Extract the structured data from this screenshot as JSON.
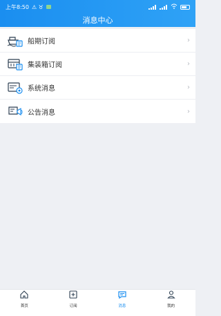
{
  "status_bar": {
    "time": "上午8:50",
    "left_glyphs": "⚠ ♉",
    "battery": "55"
  },
  "header": {
    "title": "消息中心"
  },
  "menu": {
    "items": [
      {
        "label": "船期订阅",
        "icon": "ship-icon"
      },
      {
        "label": "集装箱订阅",
        "icon": "container-icon"
      },
      {
        "label": "系统消息",
        "icon": "system-message-icon"
      },
      {
        "label": "公告消息",
        "icon": "announcement-icon"
      }
    ]
  },
  "tabbar": {
    "tabs": [
      {
        "label": "首页",
        "icon": "home-icon",
        "active": false
      },
      {
        "label": "订阅",
        "icon": "subscribe-icon",
        "active": false
      },
      {
        "label": "消息",
        "icon": "message-icon",
        "active": true
      },
      {
        "label": "我的",
        "icon": "user-icon",
        "active": false
      }
    ]
  },
  "colors": {
    "primary": "#1a8ef0",
    "header_gradient_end": "#2fa2f6",
    "background": "#eef0f4",
    "text": "#333333"
  }
}
